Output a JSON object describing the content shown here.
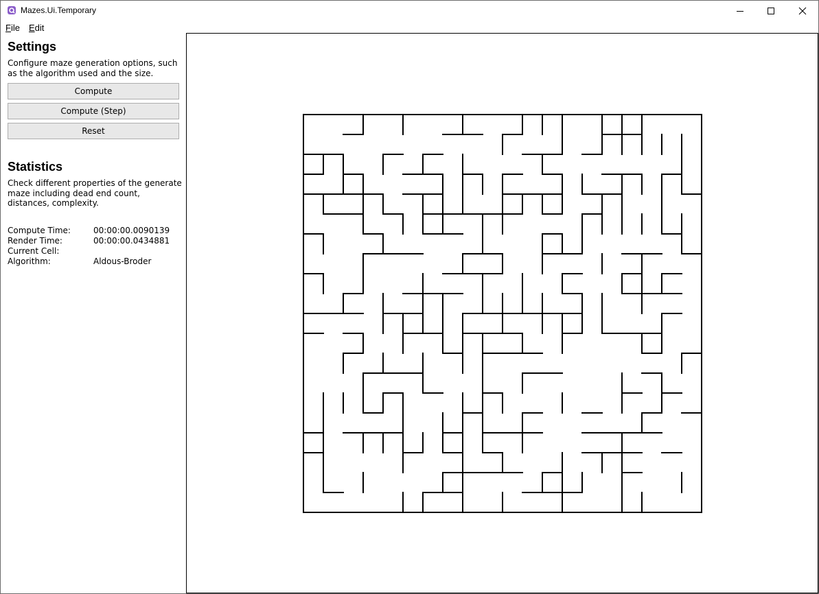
{
  "window": {
    "title": "Mazes.Ui.Temporary"
  },
  "menu": {
    "file": {
      "mnemonic": "F",
      "rest": "ile"
    },
    "edit": {
      "mnemonic": "E",
      "rest": "dit"
    }
  },
  "settings": {
    "heading": "Settings",
    "description": "Configure maze generation options, such as the algorithm used and the size.",
    "compute_label": "Compute",
    "compute_step_label": "Compute (Step)",
    "reset_label": "Reset"
  },
  "statistics": {
    "heading": "Statistics",
    "description": "Check different properties of the generate maze including dead end count, distances, complexity.",
    "rows": [
      {
        "label": "Compute Time:",
        "value": "00:00:00.0090139"
      },
      {
        "label": "Render Time:",
        "value": "00:00:00.0434881"
      },
      {
        "label": "Current Cell:",
        "value": ""
      },
      {
        "label": "Algorithm:",
        "value": "Aldous-Broder"
      }
    ]
  },
  "maze": {
    "rows": 20,
    "columns": 20,
    "wall_color": "#000000"
  },
  "icons": {
    "app": "app-icon",
    "minimize": "minimize-icon",
    "maximize": "maximize-icon",
    "close": "close-icon"
  }
}
